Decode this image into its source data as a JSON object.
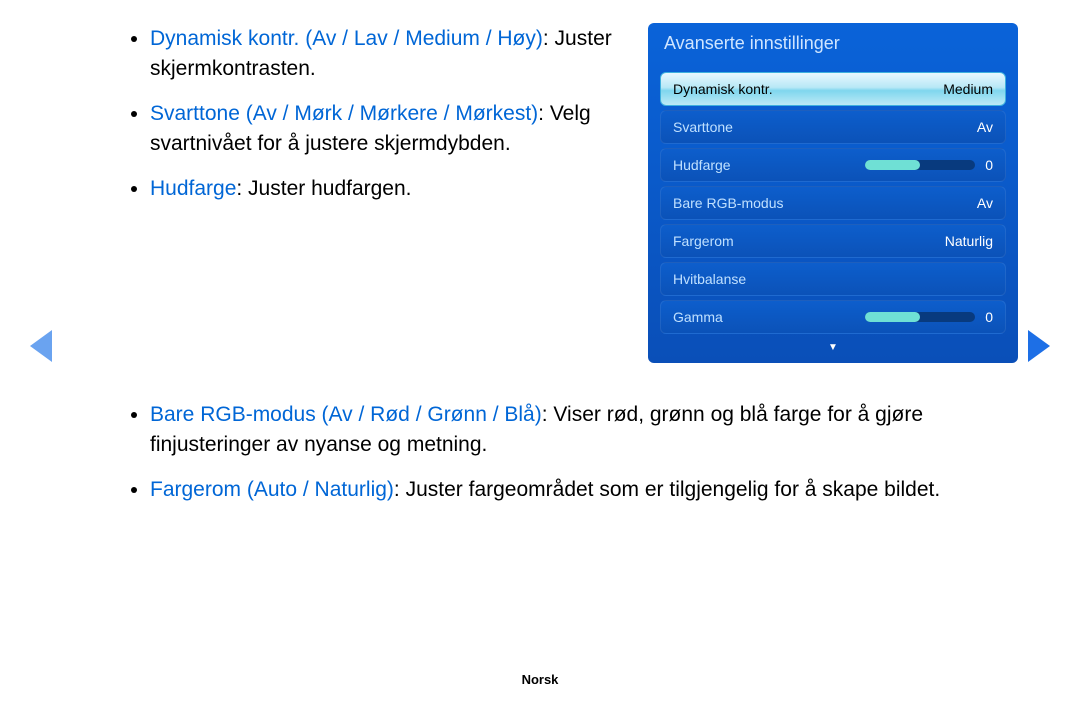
{
  "bullets_top": [
    {
      "term": "Dynamisk kontr. (Av / Lav / Medium / Høy)",
      "desc": ": Juster skjermkontrasten."
    },
    {
      "term": "Svarttone (Av / Mørk / Mørkere / Mørkest)",
      "desc": ": Velg svartnivået for å justere skjermdybden."
    },
    {
      "term": "Hudfarge",
      "desc": ": Juster hudfargen."
    }
  ],
  "bullets_bottom": [
    {
      "term": "Bare RGB-modus (Av / Rød / Grønn / Blå)",
      "desc": ": Viser rød, grønn og blå farge for å gjøre finjusteringer av nyanse og metning."
    },
    {
      "term": "Fargerom (Auto / Naturlig)",
      "desc": ": Juster fargeområdet som er tilgjengelig for å skape bildet."
    }
  ],
  "panel": {
    "title": "Avanserte innstillinger",
    "rows": [
      {
        "label": "Dynamisk kontr.",
        "value": "Medium",
        "selected": true
      },
      {
        "label": "Svarttone",
        "value": "Av"
      },
      {
        "label": "Hudfarge",
        "value": "0",
        "slider": true
      },
      {
        "label": "Bare RGB-modus",
        "value": "Av"
      },
      {
        "label": "Fargerom",
        "value": "Naturlig"
      },
      {
        "label": "Hvitbalanse",
        "value": ""
      },
      {
        "label": "Gamma",
        "value": "0",
        "slider": true
      }
    ],
    "more": "▼"
  },
  "footer": "Norsk"
}
